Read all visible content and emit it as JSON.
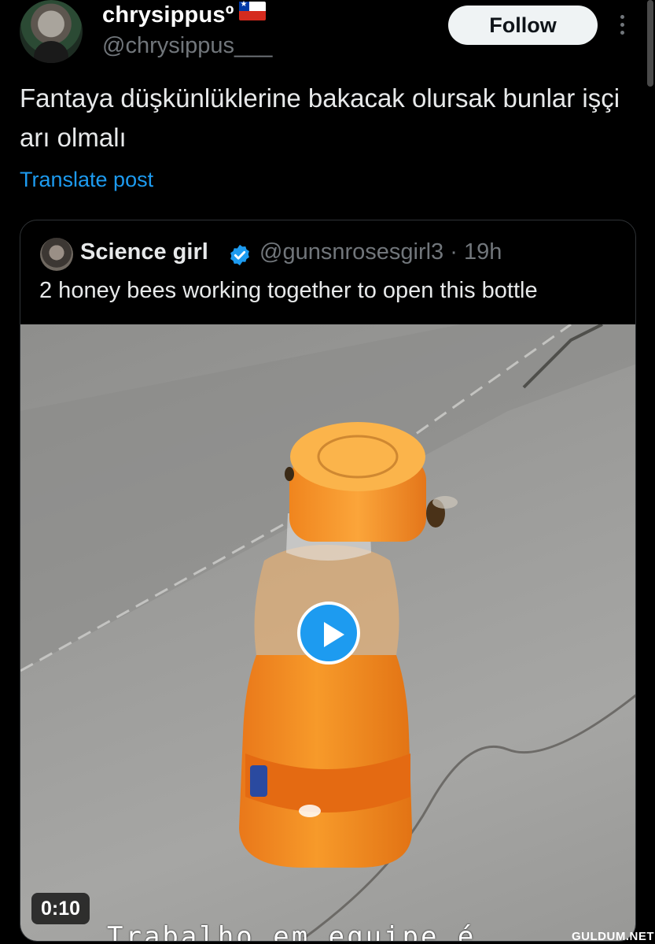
{
  "post": {
    "author_name": "chrysippusº",
    "flag_icon": "chile-flag-icon",
    "author_handle": "@chrysippus___",
    "follow_label": "Follow",
    "text": "Fantaya düşkünlüklerine bakacak olursak bunlar işçi arı olmalı",
    "translate_label": "Translate post"
  },
  "quoted": {
    "author_name": "Science girl",
    "verified_icon": "verified-badge-icon",
    "handle_time": "@gunsnrosesgirl3 · 19h",
    "text": "2 honey bees working together to open this bottle",
    "video": {
      "duration": "0:10",
      "caption": "Trabalho em equipe é",
      "play_icon": "play-icon"
    }
  },
  "watermark": "GULDUM.NET",
  "colors": {
    "background": "#000000",
    "link": "#1d9bf0",
    "secondary_text": "#71767b",
    "bottle_orange": "#f28a1c"
  }
}
